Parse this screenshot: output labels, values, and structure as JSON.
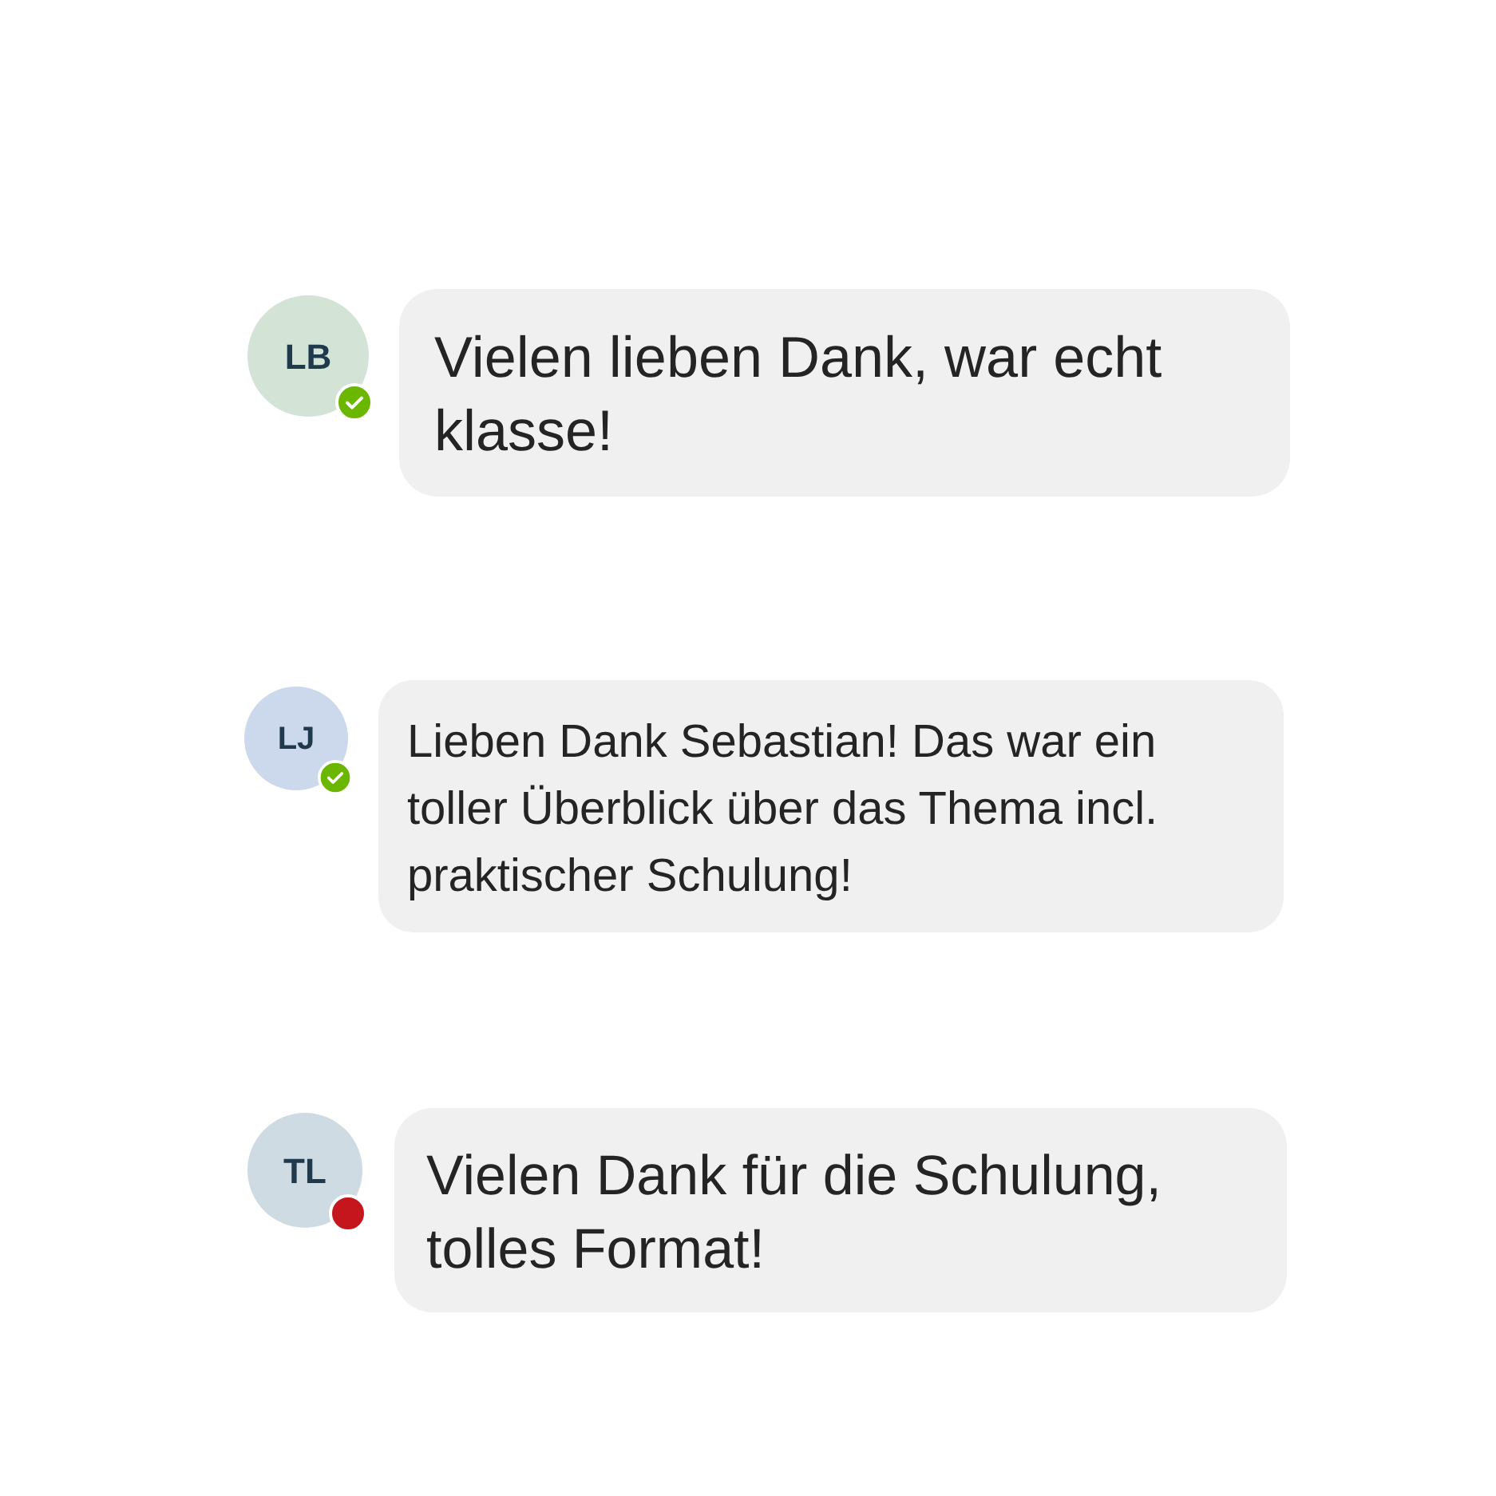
{
  "messages": [
    {
      "initials": "LB",
      "color": "#d3e3d6",
      "kind": "available",
      "text": "Vielen lieben Dank, war echt klasse!"
    },
    {
      "initials": "LJ",
      "color": "#ccd8ec",
      "kind": "available",
      "text": "Lieben Dank Sebastian! Das war ein toller Überblick über das Thema incl. praktischer Schulung!"
    },
    {
      "initials": "TL",
      "color": "#cfdbe3",
      "kind": "busy",
      "text": "Vielen Dank für die Schulung, tolles Format!"
    }
  ]
}
